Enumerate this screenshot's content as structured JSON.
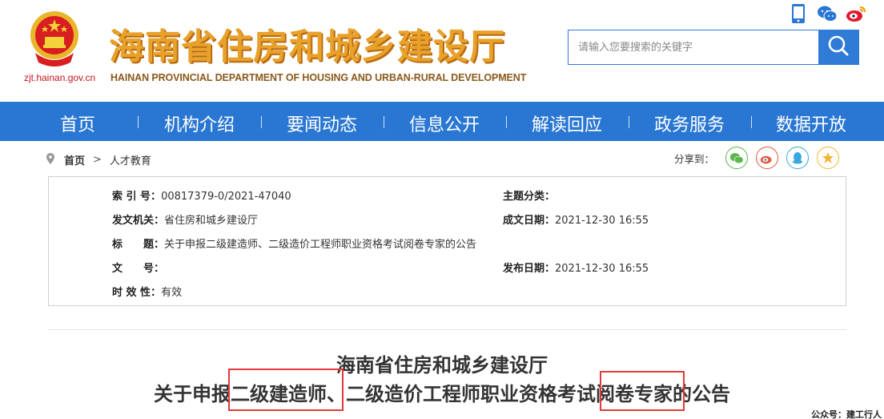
{
  "header": {
    "site_url": "zjt.hainan.gov.cn",
    "title": "海南省住房和城乡建设厅",
    "subtitle": "HAINAN PROVINCIAL DEPARTMENT OF HOUSING AND URBAN-RURAL DEVELOPMENT",
    "icons": [
      "mobile-icon",
      "wechat-icon",
      "weibo-icon"
    ],
    "search_placeholder": "请输入您要搜索的关键字"
  },
  "nav": {
    "items": [
      "首页",
      "机构介绍",
      "要闻动态",
      "信息公开",
      "解读回应",
      "政务服务",
      "数据开放"
    ]
  },
  "breadcrumb": {
    "home": "首页",
    "separator": ">",
    "current": "人才教育"
  },
  "share": {
    "label": "分享到：",
    "targets": [
      "wechat-icon",
      "weibo-icon",
      "qq-icon",
      "qzone-icon"
    ]
  },
  "info": {
    "index_label": "索 引 号：",
    "index_value": "00817379-0/2021-47040",
    "category_label": "主题分类：",
    "category_value": "",
    "issuer_label": "发文机关：",
    "issuer_value": "省住房和城乡建设厅",
    "created_label": "成文日期：",
    "created_value": "2021-12-30 16:55",
    "title_label": "标　　题：",
    "title_value": "关于申报二级建造师、二级造价工程师职业资格考试阅卷专家的公告",
    "docno_label": "文　　号：",
    "docno_value": "",
    "published_label": "发布日期：",
    "published_value": "2021-12-30 16:55",
    "validity_label": "时 效 性：",
    "validity_value": "有效"
  },
  "article": {
    "line1": "海南省住房和城乡建设厅",
    "line2": "关于申报二级建造师、二级造价工程师职业资格考试阅卷专家的公告"
  },
  "watermark": "公众号：建工行人",
  "colors": {
    "brand_blue": "#2a77d3",
    "title_orange": "#e8a12a",
    "highlight_red": "#e23a3a"
  }
}
